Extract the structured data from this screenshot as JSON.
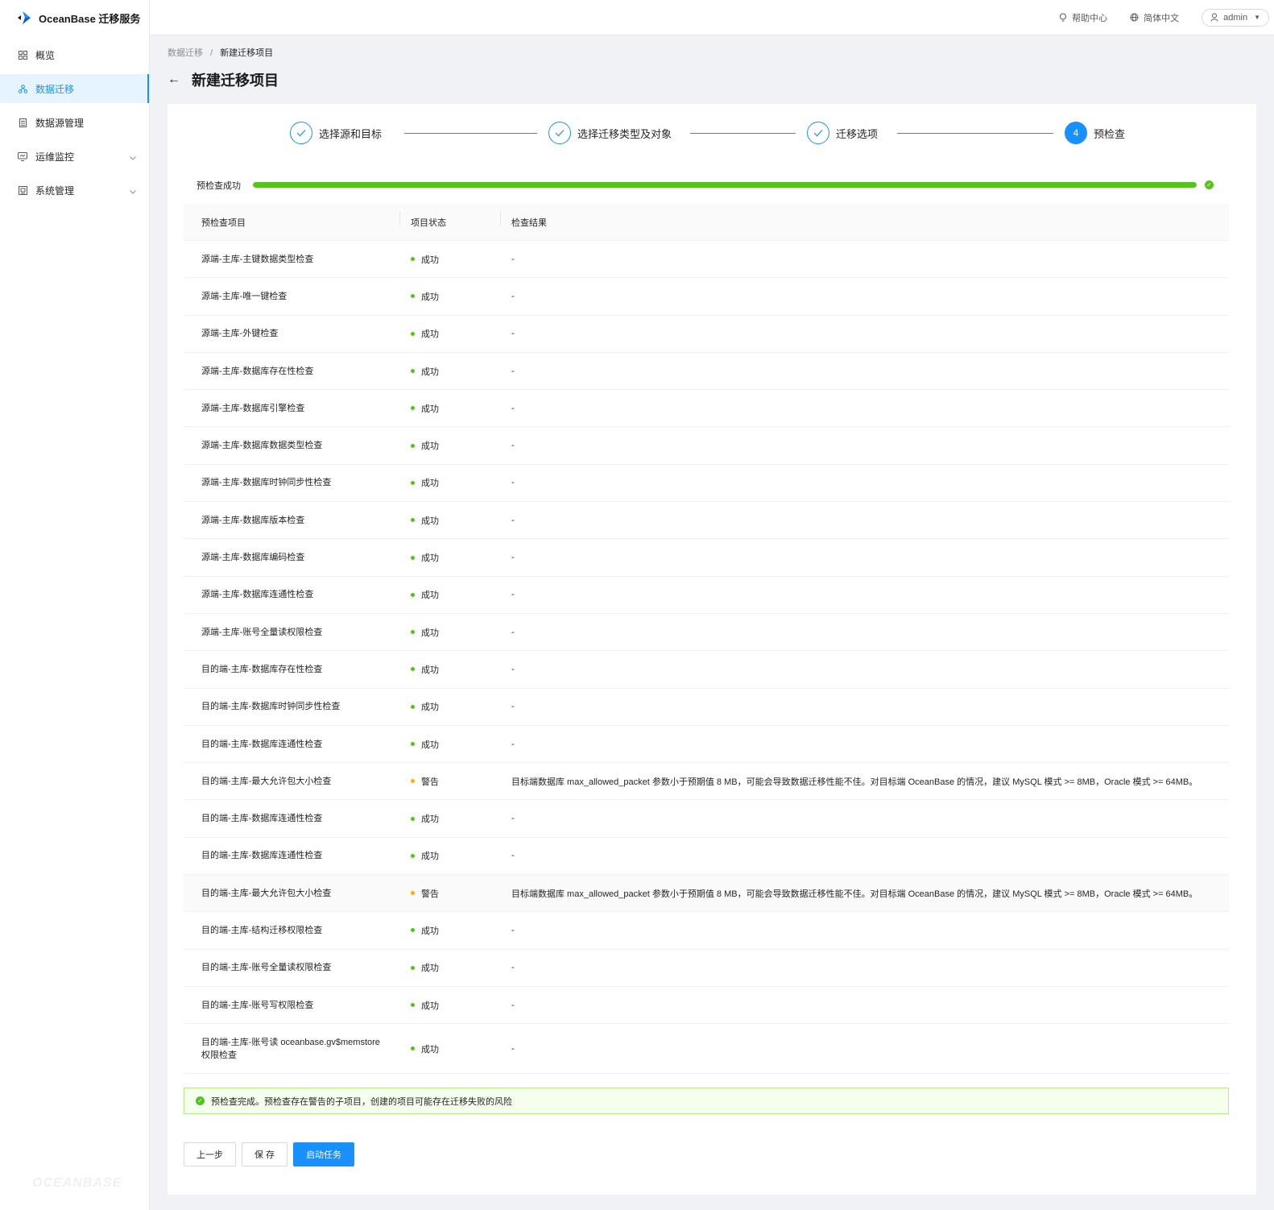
{
  "app": {
    "title": "OceanBase 迁移服务",
    "footer_logo": "OCEANBASE"
  },
  "sidebar": {
    "items": [
      {
        "label": "概览",
        "icon": "grid-icon"
      },
      {
        "label": "数据迁移",
        "icon": "sitemap-icon",
        "active": true
      },
      {
        "label": "数据源管理",
        "icon": "database-icon"
      },
      {
        "label": "运维监控",
        "icon": "monitor-icon",
        "expandable": true
      },
      {
        "label": "系统管理",
        "icon": "settings-icon",
        "expandable": true
      }
    ]
  },
  "topbar": {
    "help": "帮助中心",
    "language": "简体中文",
    "user": "admin"
  },
  "breadcrumb": {
    "parent": "数据迁移",
    "separator": "/",
    "current": "新建迁移项目"
  },
  "page": {
    "title": "新建迁移项目"
  },
  "steps": [
    {
      "label": "选择源和目标",
      "status": "done"
    },
    {
      "label": "选择迁移类型及对象",
      "status": "done"
    },
    {
      "label": "迁移选项",
      "status": "done"
    },
    {
      "label": "预检查",
      "number": "4",
      "status": "current"
    }
  ],
  "progress": {
    "label": "预检查成功",
    "percent": 100,
    "color": "#52c41a"
  },
  "table": {
    "headers": [
      "预检查项目",
      "项目状态",
      "检查结果"
    ],
    "rows": [
      {
        "item": "源端-主库-主键数据类型检查",
        "status": "成功",
        "level": "success",
        "result": "-"
      },
      {
        "item": "源端-主库-唯一键检查",
        "status": "成功",
        "level": "success",
        "result": "-"
      },
      {
        "item": "源端-主库-外键检查",
        "status": "成功",
        "level": "success",
        "result": "-"
      },
      {
        "item": "源端-主库-数据库存在性检查",
        "status": "成功",
        "level": "success",
        "result": "-"
      },
      {
        "item": "源端-主库-数据库引擎检查",
        "status": "成功",
        "level": "success",
        "result": "-"
      },
      {
        "item": "源端-主库-数据库数据类型检查",
        "status": "成功",
        "level": "success",
        "result": "-"
      },
      {
        "item": "源端-主库-数据库时钟同步性检查",
        "status": "成功",
        "level": "success",
        "result": "-"
      },
      {
        "item": "源端-主库-数据库版本检查",
        "status": "成功",
        "level": "success",
        "result": "-"
      },
      {
        "item": "源端-主库-数据库编码检查",
        "status": "成功",
        "level": "success",
        "result": "-"
      },
      {
        "item": "源端-主库-数据库连通性检查",
        "status": "成功",
        "level": "success",
        "result": "-"
      },
      {
        "item": "源端-主库-账号全量读权限检查",
        "status": "成功",
        "level": "success",
        "result": "-"
      },
      {
        "item": "目的端-主库-数据库存在性检查",
        "status": "成功",
        "level": "success",
        "result": "-"
      },
      {
        "item": "目的端-主库-数据库时钟同步性检查",
        "status": "成功",
        "level": "success",
        "result": "-"
      },
      {
        "item": "目的端-主库-数据库连通性检查",
        "status": "成功",
        "level": "success",
        "result": "-"
      },
      {
        "item": "目的端-主库-最大允许包大小检查",
        "status": "警告",
        "level": "warning",
        "result": "目标端数据库 max_allowed_packet 参数小于预期值 8 MB，可能会导致数据迁移性能不佳。对目标端 OceanBase 的情况，建议 MySQL 模式 >= 8MB，Oracle 模式 >= 64MB。"
      },
      {
        "item": "目的端-主库-数据库连通性检查",
        "status": "成功",
        "level": "success",
        "result": "-"
      },
      {
        "item": "目的端-主库-数据库连通性检查",
        "status": "成功",
        "level": "success",
        "result": "-"
      },
      {
        "item": "目的端-主库-最大允许包大小检查",
        "status": "警告",
        "level": "warning",
        "result": "目标端数据库 max_allowed_packet 参数小于预期值 8 MB，可能会导致数据迁移性能不佳。对目标端 OceanBase 的情况，建议 MySQL 模式 >= 8MB，Oracle 模式 >= 64MB。",
        "highlight": true
      },
      {
        "item": "目的端-主库-结构迁移权限检查",
        "status": "成功",
        "level": "success",
        "result": "-"
      },
      {
        "item": "目的端-主库-账号全量读权限检查",
        "status": "成功",
        "level": "success",
        "result": "-"
      },
      {
        "item": "目的端-主库-账号写权限检查",
        "status": "成功",
        "level": "success",
        "result": "-"
      },
      {
        "item": "目的端-主库-账号读 oceanbase.gv$memstore 权限检查",
        "status": "成功",
        "level": "success",
        "result": "-",
        "tall": true
      }
    ]
  },
  "colors": {
    "success": "#52c41a",
    "warning": "#faad14",
    "primary": "#1890ff"
  },
  "alert": {
    "text": "预检查完成。预检查存在警告的子项目，创建的项目可能存在迁移失败的风险"
  },
  "buttons": {
    "prev": "上一步",
    "save": "保 存",
    "start": "启动任务"
  }
}
